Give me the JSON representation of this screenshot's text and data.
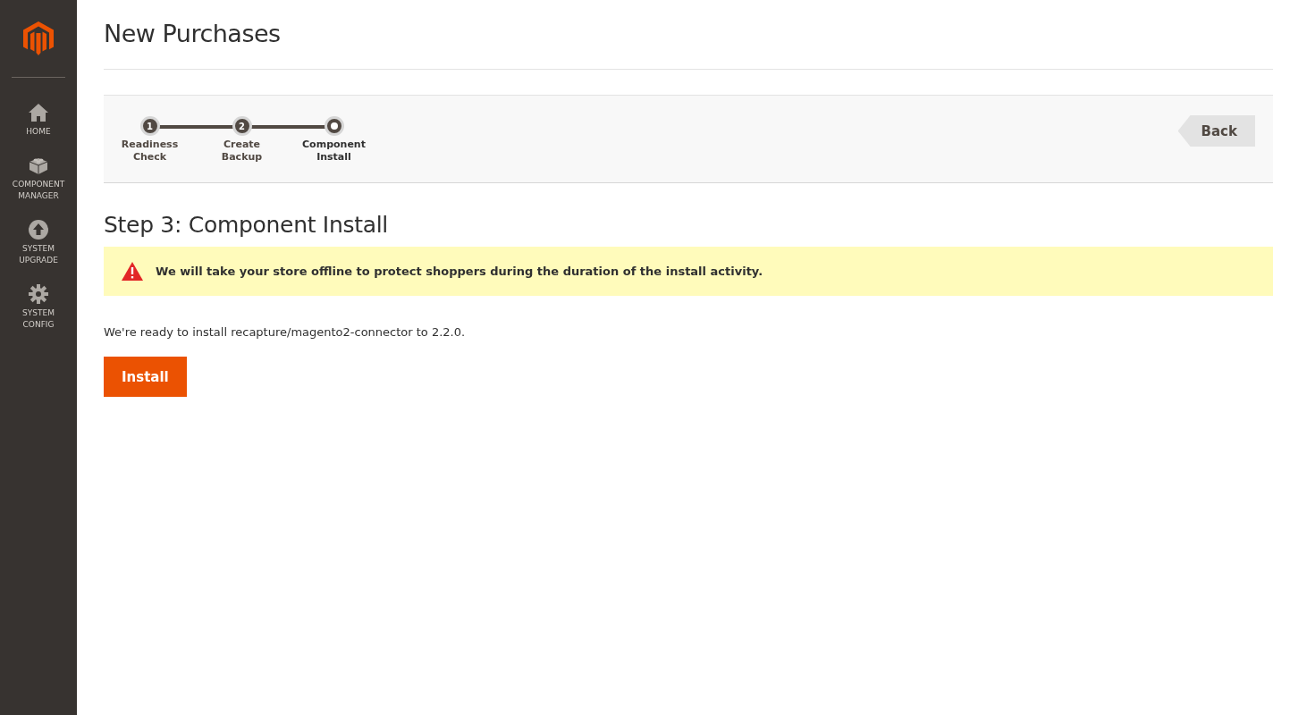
{
  "sidebar": {
    "items": [
      {
        "label": "HOME"
      },
      {
        "label": "COMPONENT MANAGER"
      },
      {
        "label": "SYSTEM UPGRADE"
      },
      {
        "label": "SYSTEM CONFIG"
      }
    ]
  },
  "page_title": "New Purchases",
  "steps": [
    {
      "number": "1",
      "label": "Readiness Check",
      "selected": false
    },
    {
      "number": "2",
      "label": "Create Backup",
      "selected": false
    },
    {
      "label": "Component Install",
      "selected": true
    }
  ],
  "back_button": "Back",
  "step_heading": "Step 3: Component Install",
  "warning": "We will take your store offline to protect shoppers during the duration of the install activity.",
  "message": "We're ready to install recapture/magento2-connector to 2.2.0.",
  "install_button": "Install"
}
